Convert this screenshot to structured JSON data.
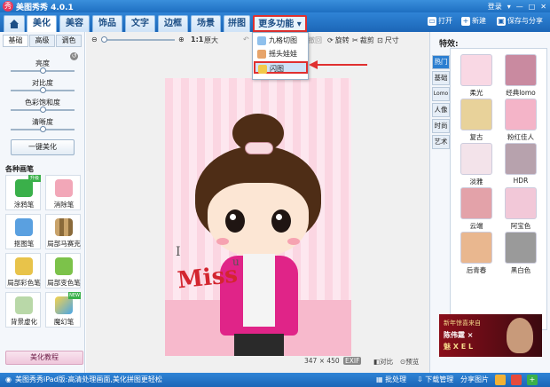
{
  "app": {
    "title": "美图秀秀 4.0.1",
    "logo": "秀"
  },
  "window": {
    "login": "登录",
    "menu": "▾",
    "minimize": "—",
    "maximize": "□",
    "close": "✕"
  },
  "nav": {
    "home_icon": "home-icon",
    "tabs": [
      "美化",
      "美容",
      "饰品",
      "文字",
      "边框",
      "场景",
      "拼图"
    ],
    "more": "更多功能 ▾",
    "actions": {
      "open": "打开",
      "new": "新建",
      "save": "保存与分享"
    }
  },
  "left": {
    "subtabs": [
      "基础",
      "高级",
      "调色"
    ],
    "adjust": [
      "亮度",
      "对比度",
      "色彩饱和度",
      "清晰度"
    ],
    "one_key": "一键美化",
    "brushes_title": "各种画笔",
    "brushes": [
      "涂鸦笔",
      "消除笔",
      "抠图笔",
      "局部马赛克",
      "局部彩色笔",
      "局部变色笔",
      "背景虚化",
      "魔幻笔"
    ],
    "brush_tag": "升级",
    "brush_tag_new": "NEW",
    "tutorial": "美化教程"
  },
  "canvas": {
    "toolbar": {
      "ratio": "1:1",
      "original": "原大",
      "undo_label": "撤回",
      "rotate": "旋转",
      "crop": "裁剪",
      "size": "尺寸"
    },
    "photo_text": {
      "i": "I",
      "miss": "Miss",
      "u": "u"
    },
    "dimensions": "347 × 450",
    "exif": "EXIF",
    "compare": "对比",
    "preview": "预览"
  },
  "dropdown": {
    "items": [
      "九格切图",
      "摇头娃娃",
      "闪图"
    ]
  },
  "right": {
    "title": "特效:",
    "vtabs": [
      "热门",
      "基础",
      "Lomo",
      "人像",
      "时尚",
      "艺术"
    ],
    "filters": [
      "柔光",
      "经典lomo",
      "复古",
      "粉红佳人",
      "淡雅",
      "HDR",
      "云端",
      "阿宝色",
      "后青春",
      "黑白色"
    ],
    "ad": {
      "line1": "新年惊喜来自",
      "line2": "陈伟霆 ×",
      "line3": "魅 X E L"
    }
  },
  "status": {
    "news": "美图秀秀iPad版:高清处理画面,美化拼图更轻松",
    "batch": "批处理",
    "download": "下载管理",
    "share": "分享图片"
  },
  "colors": {
    "accent": "#1c66b7",
    "highlight": "#e03030"
  }
}
